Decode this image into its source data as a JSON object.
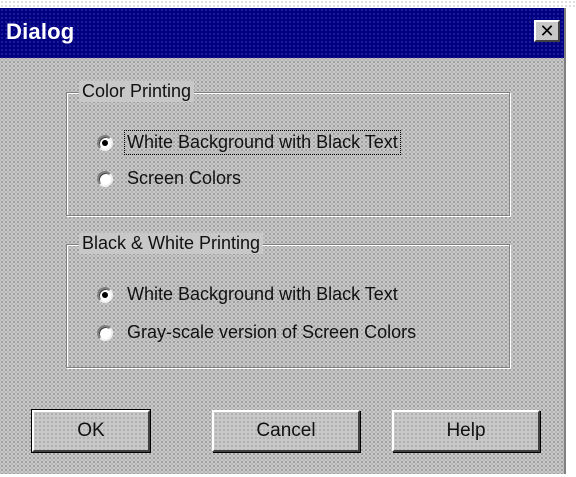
{
  "window": {
    "title": "Dialog",
    "close_label": "✕"
  },
  "color_printing": {
    "label": "Color Printing",
    "options": [
      {
        "label": "White Background with Black Text",
        "selected": true
      },
      {
        "label": "Screen Colors",
        "selected": false
      }
    ]
  },
  "bw_printing": {
    "label": "Black & White Printing",
    "options": [
      {
        "label": "White Background with Black Text",
        "selected": true
      },
      {
        "label": "Gray-scale version of Screen Colors",
        "selected": false
      }
    ]
  },
  "buttons": {
    "ok": "OK",
    "cancel": "Cancel",
    "help": "Help"
  }
}
